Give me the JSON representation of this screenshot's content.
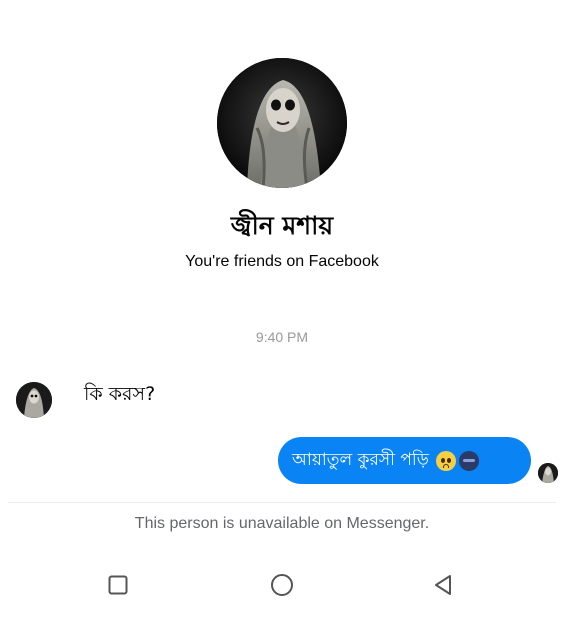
{
  "profile": {
    "name": "জ্বীন মশায়",
    "relationship_note": "You're friends on Facebook"
  },
  "conversation": {
    "timestamp": "9:40 PM",
    "incoming_message": "কি করস?",
    "outgoing_message": "আয়াতুল কুরসী পড়ি",
    "outgoing_emojis": [
      "worried-face-emoji",
      "dark-face-emoji"
    ]
  },
  "footer": {
    "unavailable_note": "This person is unavailable on Messenger."
  },
  "system_nav": {
    "icons": [
      "recent-apps-icon",
      "home-icon",
      "back-icon"
    ]
  },
  "colors": {
    "bubble_blue": "#0a84f5",
    "timestamp_gray": "#9a9a9a",
    "note_gray": "#65676b"
  }
}
